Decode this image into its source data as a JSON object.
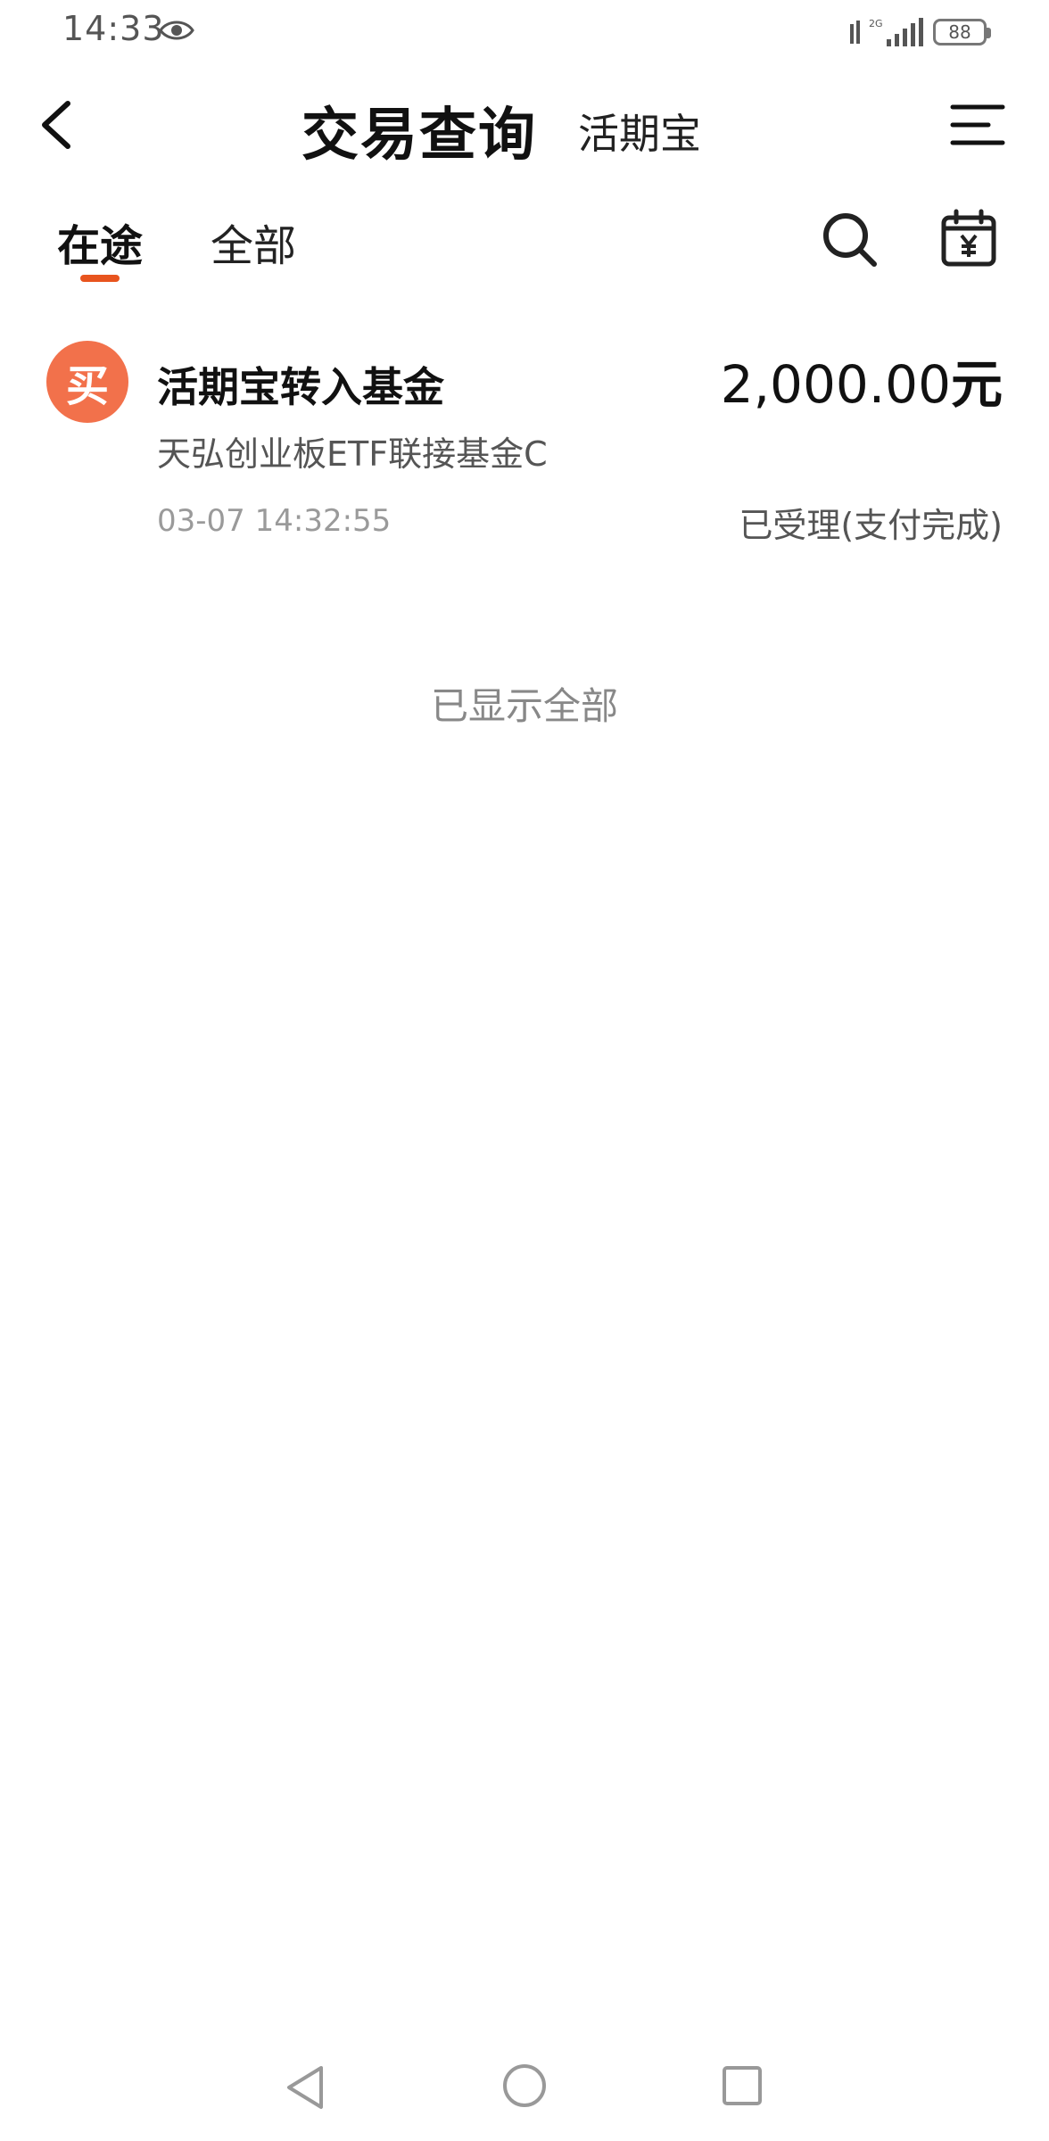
{
  "status_bar": {
    "time": "14:33",
    "network": "2G",
    "battery": "88"
  },
  "nav": {
    "title": "交易查询",
    "subtitle": "活期宝"
  },
  "tabs": [
    {
      "label": "在途",
      "active": true
    },
    {
      "label": "全部",
      "active": false
    }
  ],
  "transaction": {
    "badge": "买",
    "title": "活期宝转入基金",
    "amount": "2,000.00",
    "amount_unit": "元",
    "fund_name": "天弘创业板ETF联接基金C",
    "time": "03-07 14:32:55",
    "status": "已受理(支付完成)"
  },
  "footer_note": "已显示全部",
  "colors": {
    "accent": "#e8541e",
    "badge": "#f2714b"
  }
}
